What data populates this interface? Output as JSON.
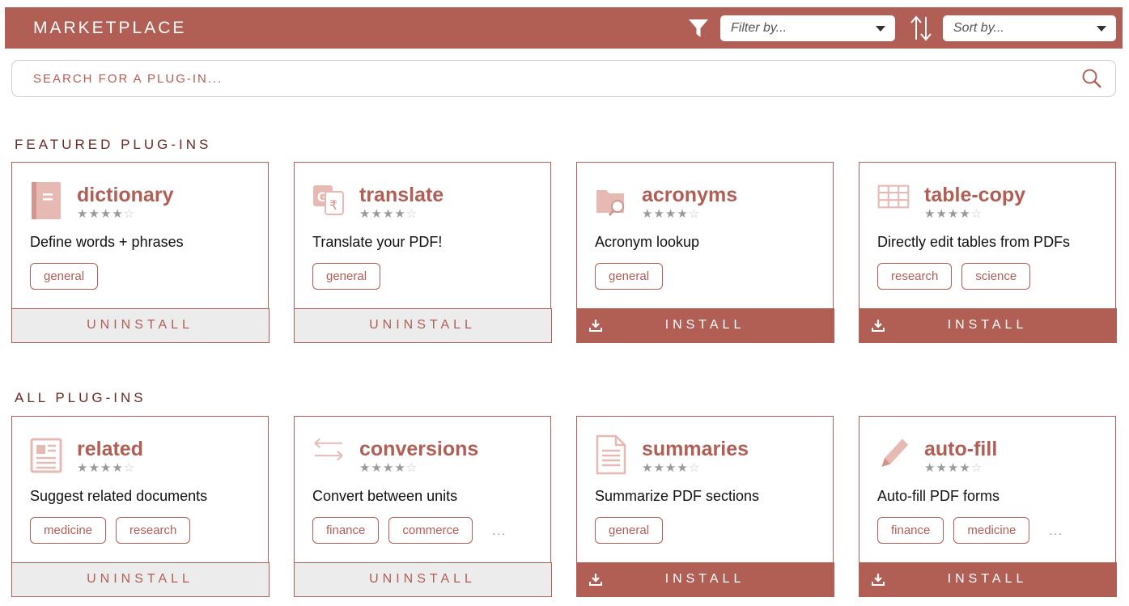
{
  "header": {
    "title": "MARKETPLACE",
    "filter_placeholder": "Filter by...",
    "sort_placeholder": "Sort by..."
  },
  "search": {
    "placeholder": "SEARCH FOR A PLUG-IN..."
  },
  "featured": {
    "title": "FEATURED PLUG-INS",
    "cards": [
      {
        "name": "dictionary",
        "icon": "book-icon",
        "stars": "★★★★",
        "half": "☆",
        "description": "Define words + phrases",
        "tags": [
          "general"
        ],
        "action": "UNINSTALL"
      },
      {
        "name": "translate",
        "icon": "translate-icon",
        "stars": "★★★★",
        "half": "☆",
        "description": "Translate your PDF!",
        "tags": [
          "general"
        ],
        "action": "UNINSTALL"
      },
      {
        "name": "acronyms",
        "icon": "folder-search-icon",
        "stars": "★★★★",
        "half": "☆",
        "description": "Acronym lookup",
        "tags": [
          "general"
        ],
        "action": "INSTALL"
      },
      {
        "name": "table-copy",
        "icon": "table-icon",
        "stars": "★★★★",
        "half": "☆",
        "description": "Directly edit tables from PDFs",
        "tags": [
          "research",
          "science"
        ],
        "action": "INSTALL"
      }
    ]
  },
  "all": {
    "title": "ALL PLUG-INS",
    "cards": [
      {
        "name": "related",
        "icon": "newspaper-icon",
        "stars": "★★★★",
        "half": "☆",
        "description": "Suggest related documents",
        "tags": [
          "medicine",
          "research"
        ],
        "action": "UNINSTALL"
      },
      {
        "name": "conversions",
        "icon": "arrows-exchange-icon",
        "stars": "★★★★",
        "half": "☆",
        "description": "Convert between units",
        "tags": [
          "finance",
          "commerce"
        ],
        "more": "...",
        "action": "UNINSTALL"
      },
      {
        "name": "summaries",
        "icon": "document-icon",
        "stars": "★★★★",
        "half": "☆",
        "description": "Summarize PDF sections",
        "tags": [
          "general"
        ],
        "action": "INSTALL"
      },
      {
        "name": "auto-fill",
        "icon": "pencil-icon",
        "stars": "★★★★",
        "half": "☆",
        "description": "Auto-fill PDF forms",
        "tags": [
          "finance",
          "medicine"
        ],
        "more": "...",
        "action": "INSTALL"
      }
    ]
  },
  "colors": {
    "accent": "#b15e55",
    "icon_tint": "#dfa9a2",
    "uninstall_bg": "#ececec"
  }
}
